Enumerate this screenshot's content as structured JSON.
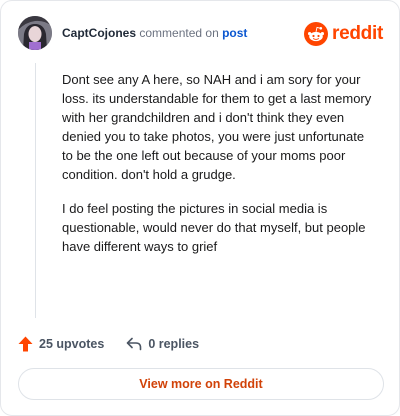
{
  "comment": {
    "author": "CaptCojones",
    "action_text": "commented on",
    "post_link": "post",
    "paragraphs": [
      "Dont see any A here, so NAH and i am sory for your loss. its understandable for them to get a last memory with her grandchildren and i don't think they even denied you to take photos, you were just unfortunate to be the one left out because of your moms poor condition. don't hold a grudge.",
      "I do feel posting the pictures in social media is questionable, would never do that myself, but people have different ways to grief"
    ]
  },
  "brand": {
    "name": "reddit",
    "icon": "reddit-snoo-icon",
    "color": "#ff4500"
  },
  "actions": {
    "upvotes": "25 upvotes",
    "replies": "0 replies",
    "upvote_icon": "upvote-arrow-icon",
    "reply_icon": "reply-arrow-icon",
    "upvote_color": "#ff4500"
  },
  "footer": {
    "view_more": "View more on Reddit"
  }
}
